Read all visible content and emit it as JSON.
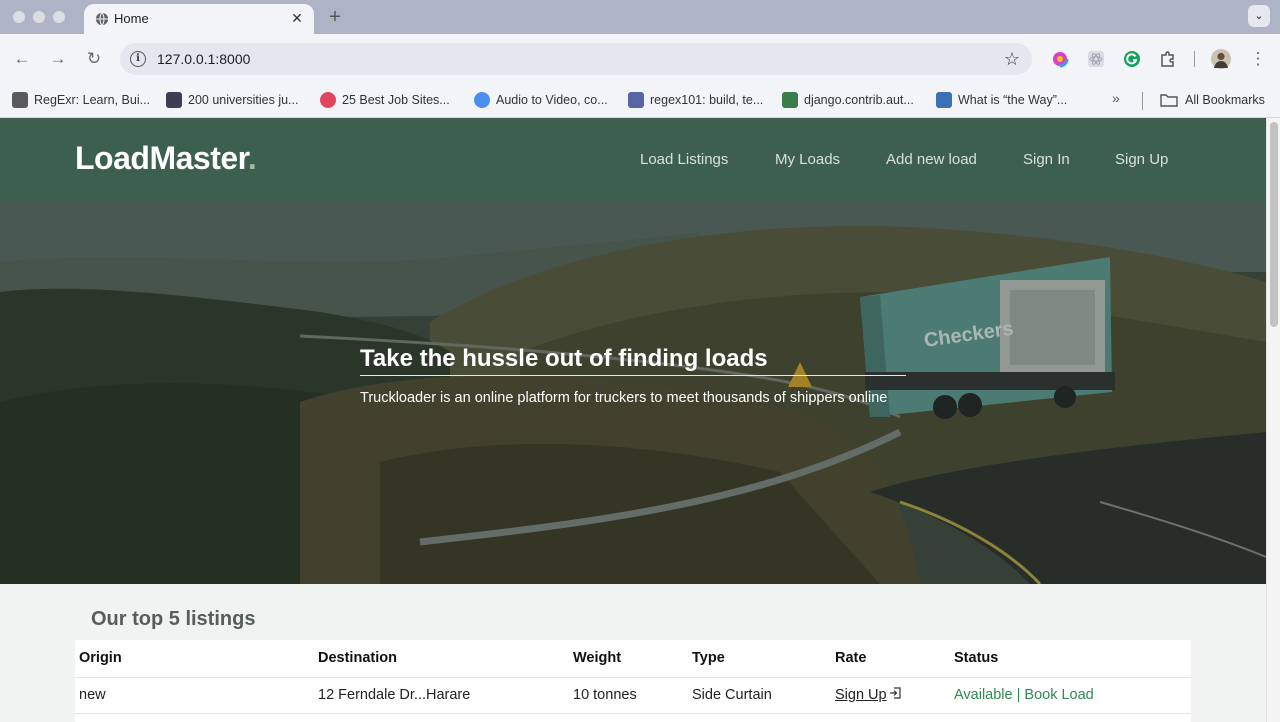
{
  "browser": {
    "tab_title": "Home",
    "url": "127.0.0.1:8000",
    "bookmarks": [
      {
        "label": "RegExr: Learn, Bui...",
        "icon": "regexr-icon",
        "color": "#5a5a5a"
      },
      {
        "label": "200 universities ju...",
        "icon": "mastodon-icon",
        "color": "#3d3d54"
      },
      {
        "label": "25 Best Job Sites...",
        "icon": "jobsites-icon",
        "color": "#e0455b"
      },
      {
        "label": "Audio to Video, co...",
        "icon": "audio-video-icon",
        "color": "#4a8ff0"
      },
      {
        "label": "regex101: build, te...",
        "icon": "regex101-icon",
        "color": "#5866a8"
      },
      {
        "label": "django.contrib.aut...",
        "icon": "django-icon",
        "color": "#3a7d4a"
      },
      {
        "label": "What is “the Way”...",
        "icon": "stackexchange-icon",
        "color": "#3b6fb6"
      }
    ],
    "all_bookmarks": "All Bookmarks"
  },
  "site": {
    "logo": "LoadMaster",
    "logo_dot": ".",
    "nav": [
      "Load Listings",
      "My Loads",
      "Add new load",
      "Sign In",
      "Sign Up"
    ]
  },
  "hero": {
    "title": "Take the hussle out of finding loads",
    "subtitle": "Truckloader is an online platform for truckers to meet thousands of shippers online"
  },
  "listings": {
    "title": "Our top 5 listings",
    "columns": [
      "Origin",
      "Destination",
      "Weight",
      "Type",
      "Rate",
      "Status"
    ],
    "rows": [
      {
        "origin": "new",
        "destination": "12 Ferndale Dr...Harare",
        "weight": "10 tonnes",
        "type": "Side Curtain",
        "rate": "Sign Up",
        "status": "Available | Book Load"
      }
    ]
  },
  "colors": {
    "header": "#3c5f4e",
    "status": "#2f8a53"
  }
}
